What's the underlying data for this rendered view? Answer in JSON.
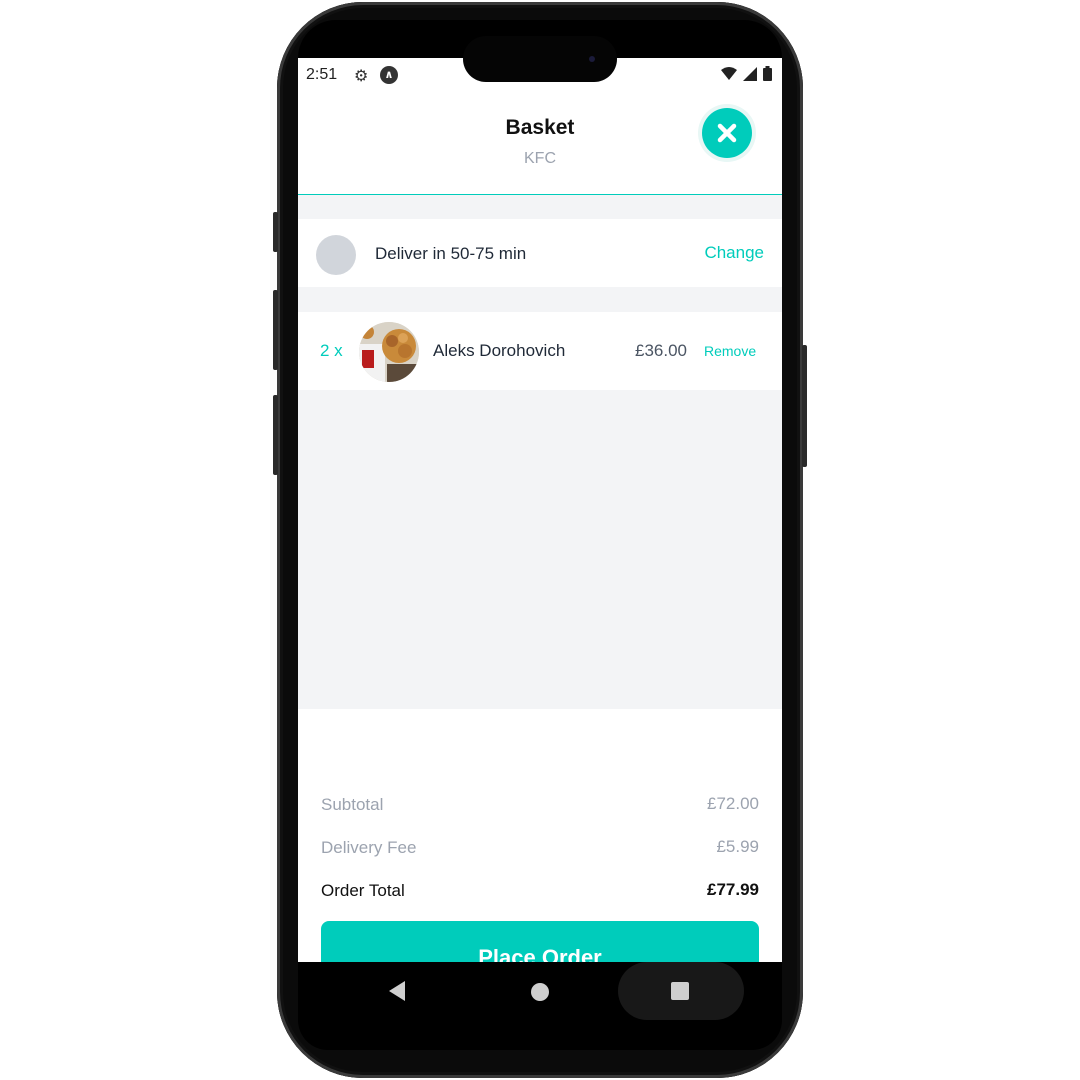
{
  "status_bar": {
    "time": "2:51"
  },
  "header": {
    "title": "Basket",
    "subtitle": "KFC"
  },
  "delivery": {
    "text": "Deliver in 50-75 min",
    "change_label": "Change"
  },
  "basket_items": [
    {
      "quantity": "2 x",
      "name": "Aleks Dorohovich",
      "price": "£36.00",
      "remove_label": "Remove"
    }
  ],
  "totals": {
    "subtotal_label": "Subtotal",
    "subtotal_value": "£72.00",
    "delivery_fee_label": "Delivery Fee",
    "delivery_fee_value": "£5.99",
    "order_total_label": "Order Total",
    "order_total_value": "£77.99"
  },
  "place_order_label": "Place Order",
  "colors": {
    "accent": "#00CCBB",
    "muted_text": "#9CA3AF",
    "background_grey": "#F3F4F6"
  },
  "icons": [
    "settings-icon",
    "accessibility-icon",
    "wifi-icon",
    "signal-icon",
    "battery-icon",
    "close-icon",
    "back-icon",
    "home-icon",
    "recents-icon"
  ]
}
